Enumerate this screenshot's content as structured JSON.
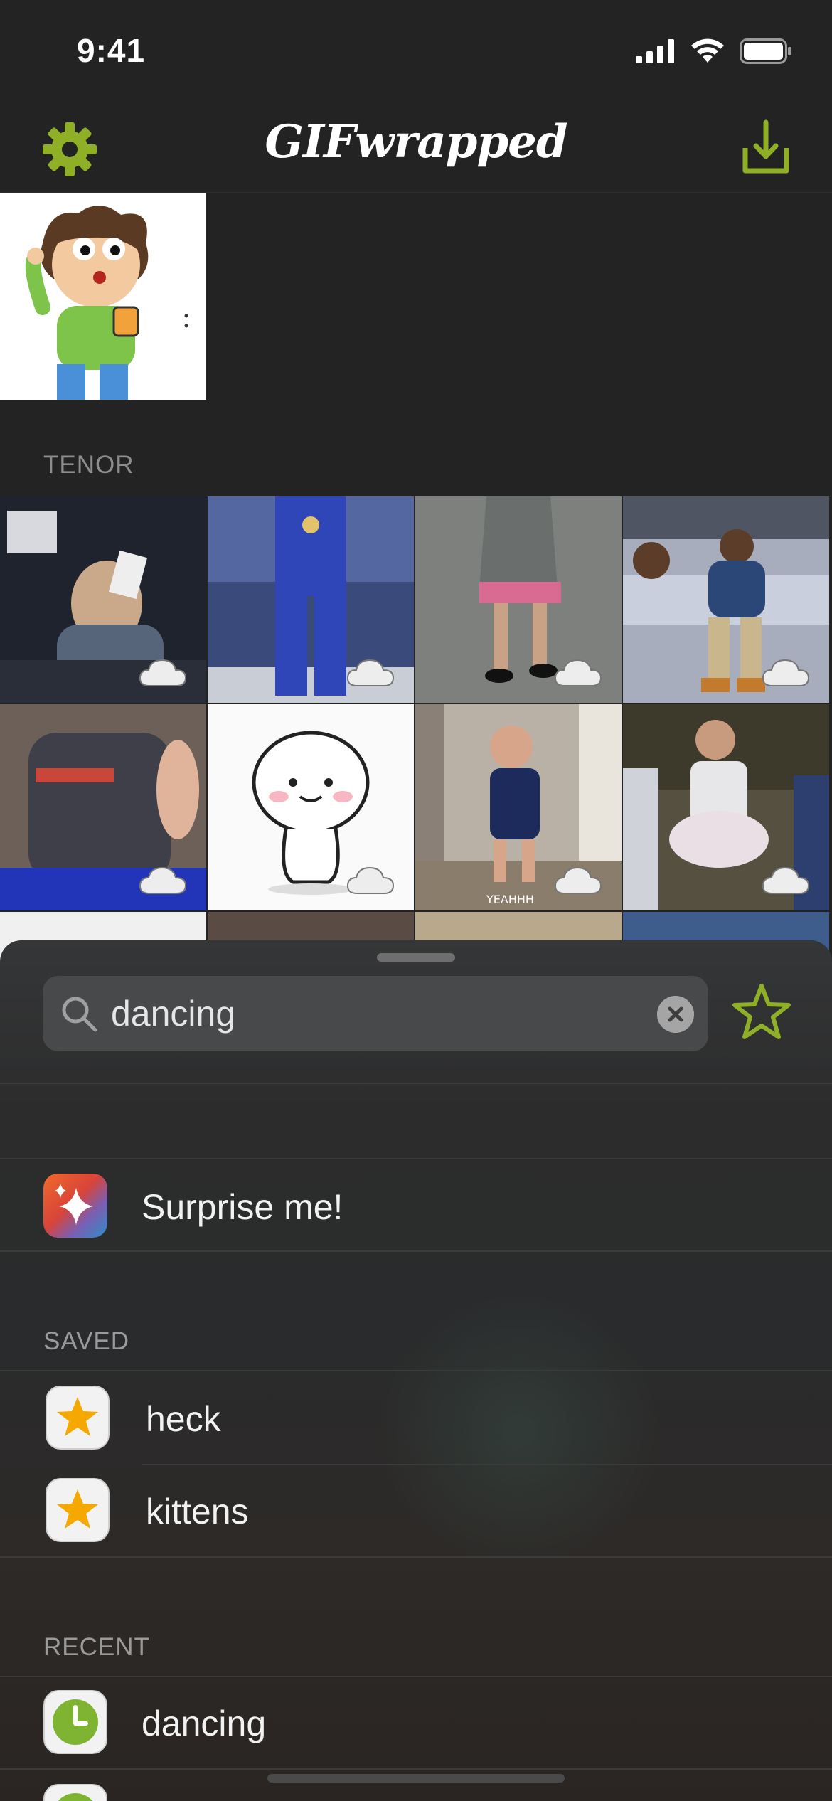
{
  "status_bar": {
    "time": "9:41"
  },
  "nav": {
    "title": "GIFwrapped"
  },
  "content": {
    "tenor_header": "TENOR",
    "grid_tiles": [
      {
        "name": "gif-tile-1"
      },
      {
        "name": "gif-tile-2"
      },
      {
        "name": "gif-tile-3"
      },
      {
        "name": "gif-tile-4"
      },
      {
        "name": "gif-tile-5"
      },
      {
        "name": "gif-tile-6"
      },
      {
        "name": "gif-tile-7"
      },
      {
        "name": "gif-tile-8"
      }
    ],
    "tile_caption": "YEAHHH"
  },
  "search": {
    "value": "dancing",
    "placeholder": "Search"
  },
  "surprise": {
    "label": "Surprise me!"
  },
  "saved": {
    "header": "SAVED",
    "items": [
      {
        "label": "heck"
      },
      {
        "label": "kittens"
      }
    ]
  },
  "recent": {
    "header": "RECENT",
    "items": [
      {
        "label": "dancing"
      }
    ]
  },
  "colors": {
    "accent": "#8fb026",
    "background": "#232323",
    "star_fill": "#f5a800"
  }
}
